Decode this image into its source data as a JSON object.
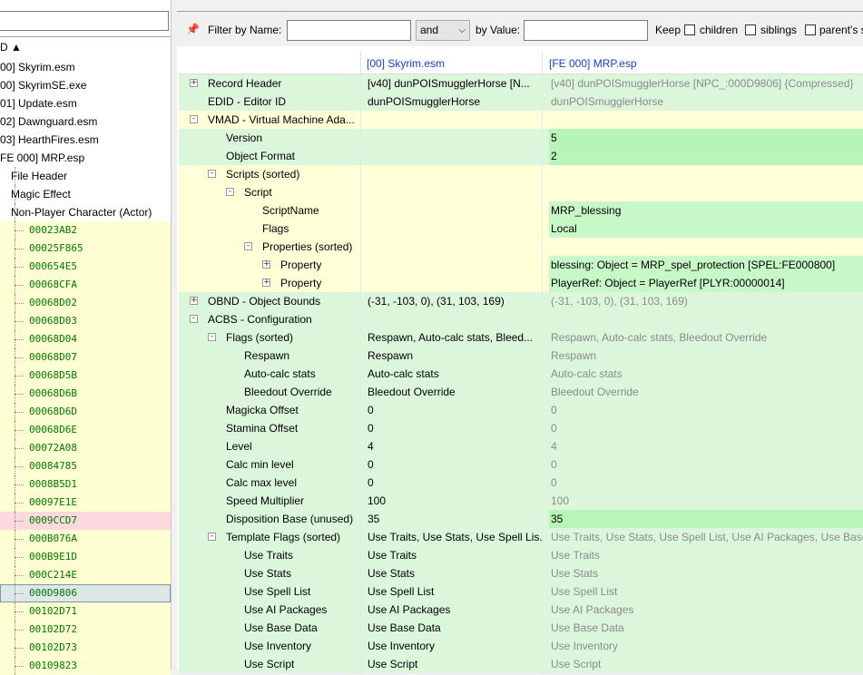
{
  "left": {
    "header": "D ▲",
    "items": [
      {
        "label": "00] Skyrim.esm",
        "indent": 0,
        "style": "plain"
      },
      {
        "label": "00] SkyrimSE.exe",
        "indent": 0,
        "style": "plain"
      },
      {
        "label": "01] Update.esm",
        "indent": 0,
        "style": "plain"
      },
      {
        "label": "02] Dawnguard.esm",
        "indent": 0,
        "style": "plain"
      },
      {
        "label": "03] HearthFires.esm",
        "indent": 0,
        "style": "plain"
      },
      {
        "label": "FE 000] MRP.esp",
        "indent": 0,
        "style": "plain"
      },
      {
        "label": "File Header",
        "indent": 1,
        "style": "plain"
      },
      {
        "label": "Magic Effect",
        "indent": 1,
        "style": "plain"
      },
      {
        "label": "Non-Player Character (Actor)",
        "indent": 1,
        "style": "plain"
      },
      {
        "label": "00023AB2",
        "indent": 2,
        "style": "y"
      },
      {
        "label": "00025F865",
        "indent": 2,
        "style": "y"
      },
      {
        "label": "000654E5",
        "indent": 2,
        "style": "y"
      },
      {
        "label": "00068CFA",
        "indent": 2,
        "style": "y"
      },
      {
        "label": "00068D02",
        "indent": 2,
        "style": "y"
      },
      {
        "label": "00068D03",
        "indent": 2,
        "style": "y"
      },
      {
        "label": "00068D04",
        "indent": 2,
        "style": "y"
      },
      {
        "label": "00068D07",
        "indent": 2,
        "style": "y"
      },
      {
        "label": "00068D5B",
        "indent": 2,
        "style": "y"
      },
      {
        "label": "00068D6B",
        "indent": 2,
        "style": "y"
      },
      {
        "label": "00068D6D",
        "indent": 2,
        "style": "y"
      },
      {
        "label": "00068D6E",
        "indent": 2,
        "style": "y"
      },
      {
        "label": "00072A08",
        "indent": 2,
        "style": "y"
      },
      {
        "label": "00084785",
        "indent": 2,
        "style": "y"
      },
      {
        "label": "0008B5D1",
        "indent": 2,
        "style": "y"
      },
      {
        "label": "00097E1E",
        "indent": 2,
        "style": "y"
      },
      {
        "label": "0009CCD7",
        "indent": 2,
        "style": "r"
      },
      {
        "label": "000B076A",
        "indent": 2,
        "style": "y"
      },
      {
        "label": "000B9E1D",
        "indent": 2,
        "style": "y"
      },
      {
        "label": "000C214E",
        "indent": 2,
        "style": "y"
      },
      {
        "label": "000D9806",
        "indent": 2,
        "style": "sel"
      },
      {
        "label": "00102D71",
        "indent": 2,
        "style": "y"
      },
      {
        "label": "00102D72",
        "indent": 2,
        "style": "y"
      },
      {
        "label": "00102D73",
        "indent": 2,
        "style": "y"
      },
      {
        "label": "00109823",
        "indent": 2,
        "style": "y"
      }
    ]
  },
  "filter": {
    "icon": "pin-icon",
    "by_name_label": "Filter by Name:",
    "name_value": "",
    "operator": "and",
    "by_value_label": "by Value:",
    "value_value": "",
    "keep_label": "Keep",
    "children_label": "children",
    "siblings_label": "siblings",
    "parents_label": "parent's s"
  },
  "grid": {
    "col1_header": "[00] Skyrim.esm",
    "col2_header": "[FE 000] MRP.esp",
    "rows": [
      {
        "name": "Record Header",
        "level": 0,
        "exp": "+",
        "bg": "g",
        "v1": "[v40] dunPOISmugglerHorse [N...",
        "v2": "[v40] dunPOISmugglerHorse [NPC_:000D9806] {Compressed}",
        "v2dim": true,
        "v2bright": false
      },
      {
        "name": "EDID - Editor ID",
        "level": 0,
        "exp": "",
        "bg": "g",
        "v1": "dunPOISmugglerHorse",
        "v2": "dunPOISmugglerHorse",
        "v2dim": true,
        "v2bright": false
      },
      {
        "name": "VMAD - Virtual Machine Ada...",
        "level": 0,
        "exp": "-",
        "bg": "y",
        "v1": "",
        "v2": "",
        "v2dim": false,
        "v2bright": false
      },
      {
        "name": "Version",
        "level": 1,
        "exp": "",
        "bg": "g",
        "v1": "",
        "v2": "5",
        "v2dim": false,
        "v2bright": true,
        "bold": true
      },
      {
        "name": "Object Format",
        "level": 1,
        "exp": "",
        "bg": "g",
        "v1": "",
        "v2": "2",
        "v2dim": false,
        "v2bright": true,
        "bold": true
      },
      {
        "name": "Scripts (sorted)",
        "level": 1,
        "exp": "-",
        "bg": "y",
        "v1": "",
        "v2": "",
        "v2dim": false,
        "v2bright": false
      },
      {
        "name": "Script",
        "level": 2,
        "exp": "-",
        "bg": "y",
        "v1": "",
        "v2": "",
        "v2dim": false,
        "v2bright": false
      },
      {
        "name": "ScriptName",
        "level": 3,
        "exp": "",
        "bg": "y",
        "v1": "",
        "v2": "MRP_blessing",
        "v2dim": false,
        "v2bright": true
      },
      {
        "name": "Flags",
        "level": 3,
        "exp": "",
        "bg": "y",
        "v1": "",
        "v2": "Local",
        "v2dim": false,
        "v2bright": true
      },
      {
        "name": "Properties (sorted)",
        "level": 3,
        "exp": "-",
        "bg": "y",
        "v1": "",
        "v2": "",
        "v2dim": false,
        "v2bright": false
      },
      {
        "name": "Property",
        "level": 4,
        "exp": "+",
        "bg": "y",
        "v1": "",
        "v2": "blessing: Object = MRP_spel_protection [SPEL:FE000800]",
        "v2dim": false,
        "v2bright": true
      },
      {
        "name": "Property",
        "level": 4,
        "exp": "+",
        "bg": "y",
        "v1": "",
        "v2": "PlayerRef: Object = PlayerRef [PLYR:00000014]",
        "v2dim": false,
        "v2bright": true
      },
      {
        "name": "OBND - Object Bounds",
        "level": 0,
        "exp": "+",
        "bg": "g",
        "v1": "(-31, -103, 0), (31, 103, 169)",
        "v2": "(-31, -103, 0), (31, 103, 169)",
        "v2dim": true,
        "v2bright": false
      },
      {
        "name": "ACBS - Configuration",
        "level": 0,
        "exp": "-",
        "bg": "g",
        "v1": "",
        "v2": "",
        "v2dim": false,
        "v2bright": false
      },
      {
        "name": "Flags (sorted)",
        "level": 1,
        "exp": "-",
        "bg": "g",
        "v1": "Respawn, Auto-calc stats, Bleed...",
        "v2": "Respawn, Auto-calc stats, Bleedout Override",
        "v2dim": true,
        "v2bright": false
      },
      {
        "name": "Respawn",
        "level": 2,
        "exp": "",
        "bg": "g",
        "v1": "Respawn",
        "v2": "Respawn",
        "v2dim": true,
        "v2bright": false
      },
      {
        "name": "Auto-calc stats",
        "level": 2,
        "exp": "",
        "bg": "g",
        "v1": "Auto-calc stats",
        "v2": "Auto-calc stats",
        "v2dim": true,
        "v2bright": false
      },
      {
        "name": "Bleedout Override",
        "level": 2,
        "exp": "",
        "bg": "g",
        "v1": "Bleedout Override",
        "v2": "Bleedout Override",
        "v2dim": true,
        "v2bright": false
      },
      {
        "name": "Magicka Offset",
        "level": 1,
        "exp": "",
        "bg": "g",
        "v1": "0",
        "v2": "0",
        "v2dim": true,
        "v2bright": false
      },
      {
        "name": "Stamina Offset",
        "level": 1,
        "exp": "",
        "bg": "g",
        "v1": "0",
        "v2": "0",
        "v2dim": true,
        "v2bright": false
      },
      {
        "name": "Level",
        "level": 1,
        "exp": "",
        "bg": "g",
        "v1": "4",
        "v2": "4",
        "v2dim": true,
        "v2bright": false
      },
      {
        "name": "Calc min level",
        "level": 1,
        "exp": "",
        "bg": "g",
        "v1": "0",
        "v2": "0",
        "v2dim": true,
        "v2bright": false
      },
      {
        "name": "Calc max level",
        "level": 1,
        "exp": "",
        "bg": "g",
        "v1": "0",
        "v2": "0",
        "v2dim": true,
        "v2bright": false
      },
      {
        "name": "Speed Multiplier",
        "level": 1,
        "exp": "",
        "bg": "g",
        "v1": "100",
        "v2": "100",
        "v2dim": true,
        "v2bright": false
      },
      {
        "name": "Disposition Base (unused)",
        "level": 1,
        "exp": "",
        "bg": "g",
        "v1": "35",
        "v2": "35",
        "v2dim": false,
        "v2bright": true,
        "bold": true
      },
      {
        "name": "Template Flags (sorted)",
        "level": 1,
        "exp": "-",
        "bg": "g",
        "v1": "Use Traits, Use Stats, Use Spell Lis...",
        "v2": "Use Traits, Use Stats, Use Spell List, Use AI Packages, Use Base Data",
        "v2dim": true,
        "v2bright": false
      },
      {
        "name": "Use Traits",
        "level": 2,
        "exp": "",
        "bg": "g",
        "v1": "Use Traits",
        "v2": "Use Traits",
        "v2dim": true,
        "v2bright": false
      },
      {
        "name": "Use Stats",
        "level": 2,
        "exp": "",
        "bg": "g",
        "v1": "Use Stats",
        "v2": "Use Stats",
        "v2dim": true,
        "v2bright": false
      },
      {
        "name": "Use Spell List",
        "level": 2,
        "exp": "",
        "bg": "g",
        "v1": "Use Spell List",
        "v2": "Use Spell List",
        "v2dim": true,
        "v2bright": false
      },
      {
        "name": "Use AI Packages",
        "level": 2,
        "exp": "",
        "bg": "g",
        "v1": "Use AI Packages",
        "v2": "Use AI Packages",
        "v2dim": true,
        "v2bright": false
      },
      {
        "name": "Use Base Data",
        "level": 2,
        "exp": "",
        "bg": "g",
        "v1": "Use Base Data",
        "v2": "Use Base Data",
        "v2dim": true,
        "v2bright": false
      },
      {
        "name": "Use Inventory",
        "level": 2,
        "exp": "",
        "bg": "g",
        "v1": "Use Inventory",
        "v2": "Use Inventory",
        "v2dim": true,
        "v2bright": false
      },
      {
        "name": "Use Script",
        "level": 2,
        "exp": "",
        "bg": "g",
        "v1": "Use Script",
        "v2": "Use Script",
        "v2dim": true,
        "v2bright": false
      }
    ]
  }
}
